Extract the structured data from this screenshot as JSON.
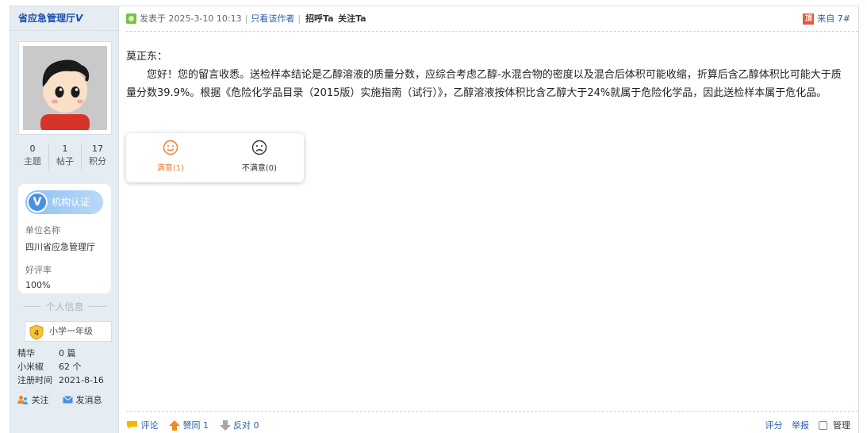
{
  "author": {
    "name": "省应急管理厅",
    "verified_mark": "V"
  },
  "stats": [
    {
      "num": "0",
      "label": "主题"
    },
    {
      "num": "1",
      "label": "帖子"
    },
    {
      "num": "17",
      "label": "积分"
    }
  ],
  "cert": {
    "badge_icon": "V",
    "badge_text": "机构认证",
    "unit_label": "单位名称",
    "unit_value": "四川省应急管理厅",
    "rating_label": "好评率",
    "rating_value": "100%"
  },
  "personal": {
    "section_title": "个人信息",
    "rank_level": "4",
    "rank_name": "小学一年级",
    "fields": [
      {
        "k": "精华",
        "v": "0 篇"
      },
      {
        "k": "小米椒",
        "v": "62 个"
      },
      {
        "k": "注册时间",
        "v": "2021-8-16"
      }
    ],
    "follow_label": "关注",
    "message_label": "发消息"
  },
  "post": {
    "posted_at": "发表于 2025-3-10 10:13",
    "only_author": "只看该作者",
    "greet": "招呼Ta",
    "follow": "关注Ta",
    "top_icon": "顶",
    "floor": "来自 7#",
    "salutation": "莫正东：",
    "body": "　　您好！您的留言收悉。送检样本结论是乙醇溶液的质量分数，应综合考虑乙醇-水混合物的密度以及混合后体积可能收缩，折算后含乙醇体积比可能大于质量分数39.9%。根据《危险化学品目录（2015版）实施指南（试行）》，乙醇溶液按体积比含乙醇大于24%就属于危险化学品，因此送检样本属于危化品。"
  },
  "rating": {
    "satisfied": "满意(1)",
    "unsatisfied": "不满意(0)",
    "satisfied_color": "#f07c28"
  },
  "footer": {
    "comment": "评论",
    "like": "赞同 1",
    "dislike": "反对 0",
    "score": "评分",
    "report": "举报",
    "manage": "管理"
  }
}
